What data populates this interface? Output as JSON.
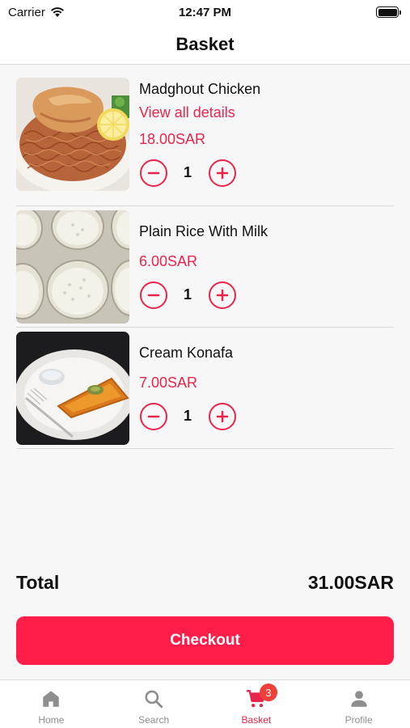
{
  "status_bar": {
    "carrier": "Carrier",
    "time": "12:47 PM"
  },
  "header": {
    "title": "Basket"
  },
  "items": [
    {
      "name": "Madghout Chicken",
      "details_link": "View all details",
      "price": "18.00SAR",
      "quantity": "1",
      "image": "chicken-rice-photo"
    },
    {
      "name": "Plain Rice With Milk",
      "price": "6.00SAR",
      "quantity": "1",
      "image": "rice-milk-photo"
    },
    {
      "name": "Cream Konafa",
      "price": "7.00SAR",
      "quantity": "1",
      "image": "konafa-photo"
    }
  ],
  "total": {
    "label": "Total",
    "value": "31.00SAR"
  },
  "checkout": {
    "label": "Checkout"
  },
  "tabs": [
    {
      "label": "Home",
      "icon": "home-icon"
    },
    {
      "label": "Search",
      "icon": "search-icon"
    },
    {
      "label": "Basket",
      "icon": "cart-icon",
      "badge": "3",
      "active": true
    },
    {
      "label": "Profile",
      "icon": "person-icon"
    }
  ],
  "colors": {
    "accent": "#e8254a",
    "button": "#ff1e4a",
    "badge": "#f0403a",
    "inactive": "#8e8e8e"
  }
}
